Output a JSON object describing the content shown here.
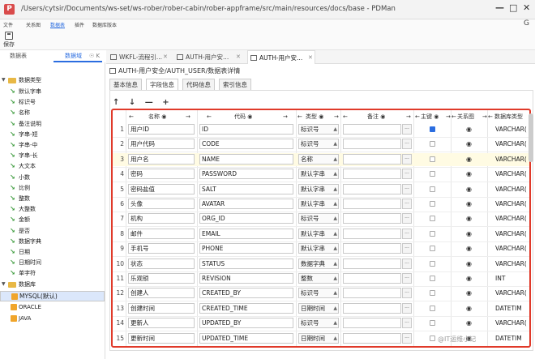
{
  "window": {
    "title": "/Users/cytsir/Documents/ws-set/ws-rober/rober-cabin/rober-appframe/src/main/resources/docs/base - PDMan",
    "app_icon": "P",
    "min": "—",
    "max": "□",
    "close": "✕",
    "back": "G"
  },
  "menus": [
    "文件",
    "关系图",
    "数据表",
    "插件",
    "数据库版本"
  ],
  "toolbar": {
    "save_label": "保存"
  },
  "side_tabs": {
    "tab1": "数据表",
    "tab2": "数据域",
    "ctrl": "☉ K"
  },
  "tree": {
    "data_types_group": "数据类型",
    "data_types": [
      "默认字串",
      "标识号",
      "名称",
      "备注说明",
      "字串-短",
      "字串-中",
      "字串-长",
      "大文本",
      "小数",
      "比例",
      "整数",
      "大整数",
      "金额",
      "是否",
      "数据字典",
      "日期",
      "日期时间",
      "单字符"
    ],
    "db_group": "数据库",
    "dbs": [
      "MYSQL(默认)",
      "ORACLE",
      "JAVA"
    ]
  },
  "doc_tabs": [
    {
      "label": "WKFL-流程引...",
      "close": "✕"
    },
    {
      "label": "AUTH-用户安...",
      "close": "✕"
    },
    {
      "label": "AUTH-用户安...",
      "close": "✕"
    }
  ],
  "breadcrumb": "AUTH-用户安全/AUTH_USER/数据表详情",
  "sub_tabs": [
    "基本信息",
    "字段信息",
    "代码信息",
    "索引信息"
  ],
  "row_tools": "↑ ↓ — +",
  "headers": {
    "name": "名称 ◉",
    "code": "代码 ◉",
    "type": "类型 ◉",
    "remark": "备注 ◉",
    "pk": "主键 ◉",
    "rel": "关系图",
    "dbtype": "数据库类型"
  },
  "rows": [
    {
      "n": "1",
      "name": "用户ID",
      "code": "ID",
      "type": "标识号",
      "pk": true,
      "dbtype": "VARCHAR("
    },
    {
      "n": "2",
      "name": "用户代码",
      "code": "CODE",
      "type": "标识号",
      "pk": false,
      "dbtype": "VARCHAR("
    },
    {
      "n": "3",
      "name": "用户名",
      "code": "NAME",
      "type": "名称",
      "pk": false,
      "dbtype": "VARCHAR("
    },
    {
      "n": "4",
      "name": "密码",
      "code": "PASSWORD",
      "type": "默认字串",
      "pk": false,
      "dbtype": "VARCHAR("
    },
    {
      "n": "5",
      "name": "密码盐值",
      "code": "SALT",
      "type": "默认字串",
      "pk": false,
      "dbtype": "VARCHAR("
    },
    {
      "n": "6",
      "name": "头像",
      "code": "AVATAR",
      "type": "默认字串",
      "pk": false,
      "dbtype": "VARCHAR("
    },
    {
      "n": "7",
      "name": "机构",
      "code": "ORG_ID",
      "type": "标识号",
      "pk": false,
      "dbtype": "VARCHAR("
    },
    {
      "n": "8",
      "name": "邮件",
      "code": "EMAIL",
      "type": "默认字串",
      "pk": false,
      "dbtype": "VARCHAR("
    },
    {
      "n": "9",
      "name": "手机号",
      "code": "PHONE",
      "type": "默认字串",
      "pk": false,
      "dbtype": "VARCHAR("
    },
    {
      "n": "10",
      "name": "状态",
      "code": "STATUS",
      "type": "数据字典",
      "pk": false,
      "dbtype": "VARCHAR("
    },
    {
      "n": "11",
      "name": "乐观锁",
      "code": "REVISION",
      "type": "整数",
      "pk": false,
      "dbtype": "INT"
    },
    {
      "n": "12",
      "name": "创建人",
      "code": "CREATED_BY",
      "type": "标识号",
      "pk": false,
      "dbtype": "VARCHAR("
    },
    {
      "n": "13",
      "name": "创建时间",
      "code": "CREATED_TIME",
      "type": "日期时间",
      "pk": false,
      "dbtype": "DATETIM"
    },
    {
      "n": "14",
      "name": "更新人",
      "code": "UPDATED_BY",
      "type": "标识号",
      "pk": false,
      "dbtype": "VARCHAR("
    },
    {
      "n": "15",
      "name": "更新时间",
      "code": "UPDATED_TIME",
      "type": "日期时间",
      "pk": false,
      "dbtype": "DATETIM"
    }
  ],
  "highlight_row": 3,
  "watermark": "@IT运维小记",
  "colors": {
    "accent": "#2b6de0",
    "highlight_border": "#e03a2a",
    "folder": "#e8b845"
  }
}
